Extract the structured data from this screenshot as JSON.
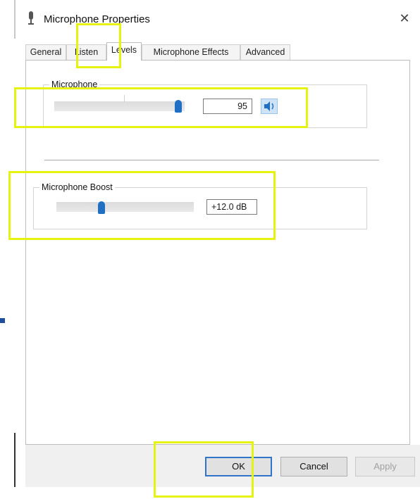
{
  "window": {
    "title": "Microphone Properties",
    "close_glyph": "✕"
  },
  "tabs": [
    {
      "label": "General",
      "active": false
    },
    {
      "label": "Listen",
      "active": false
    },
    {
      "label": "Levels",
      "active": true
    },
    {
      "label": "Microphone Effects",
      "active": false
    },
    {
      "label": "Advanced",
      "active": false
    }
  ],
  "levels": {
    "microphone": {
      "label": "Microphone",
      "value": "95",
      "level_fraction": 0.95
    },
    "boost": {
      "label": "Microphone Boost",
      "value": "+12.0 dB",
      "level_fraction": 0.33
    }
  },
  "buttons": {
    "ok": "OK",
    "cancel": "Cancel",
    "apply": "Apply"
  },
  "colors": {
    "accent": "#1f6fc5",
    "highlight": "#e6f20f"
  }
}
